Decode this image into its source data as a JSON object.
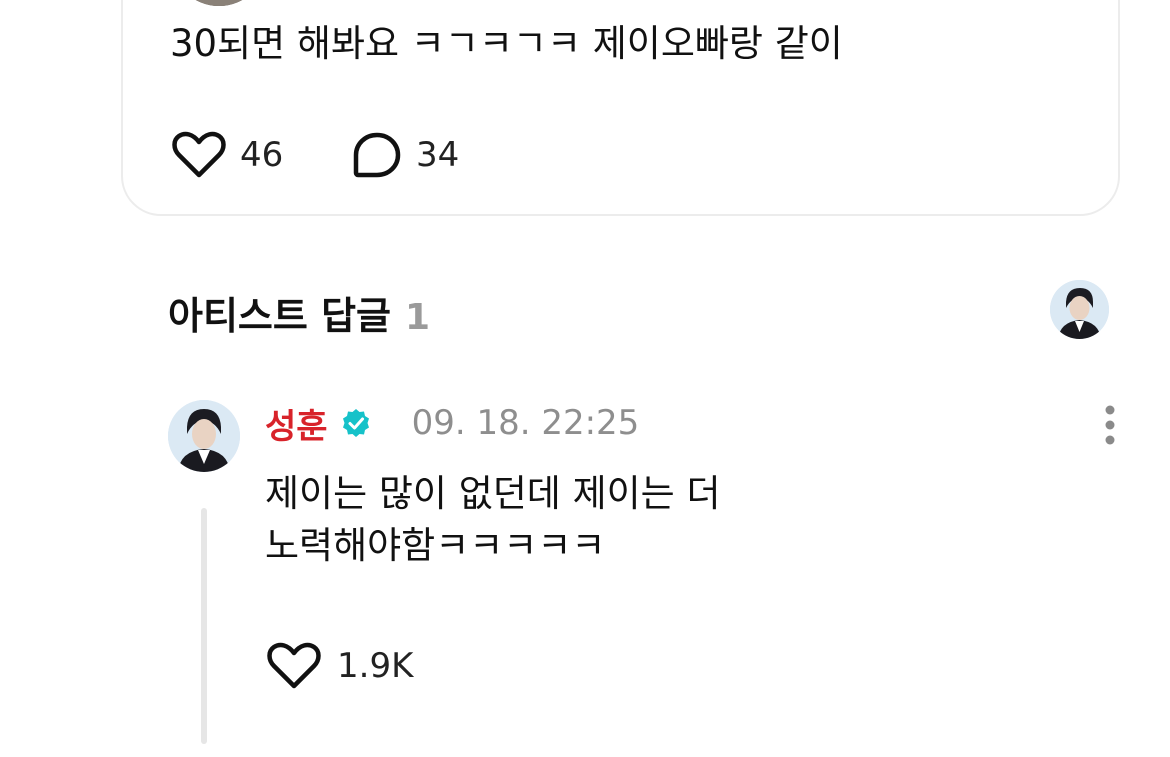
{
  "post": {
    "text": "30되면 해봐요 ㅋㄱㅋㄱㅋ 제이오빠랑 같이",
    "like_count": "46",
    "reply_count": "34"
  },
  "artist_replies": {
    "title": "아티스트 답글",
    "count": "1"
  },
  "reply": {
    "author": "성훈",
    "timestamp": "09. 18. 22:25",
    "text_line1": "제이는 많이 없던데 제이는 더",
    "text_line2": "노력해야함ㅋㅋㅋㅋㅋ",
    "like_count": "1.9K"
  },
  "colors": {
    "author_name": "#d8232a",
    "verified_badge": "#16c2c9",
    "muted_text": "#8e8e8e",
    "card_border": "#ececec"
  },
  "icons": {
    "like": "heart-outline-icon",
    "reply": "speech-bubble-icon",
    "verified": "verified-badge-icon",
    "more": "more-vertical-icon"
  }
}
